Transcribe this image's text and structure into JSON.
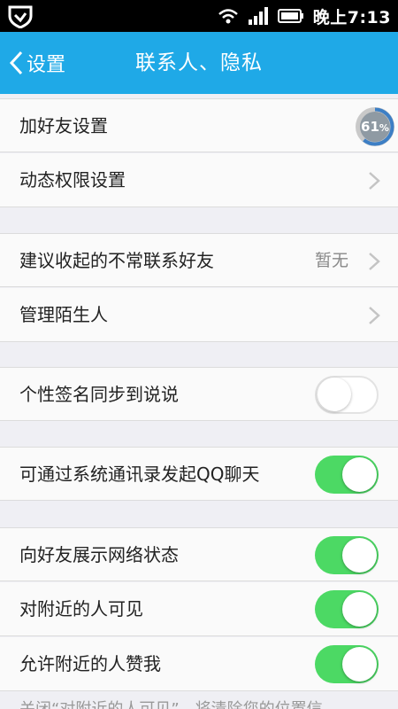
{
  "status_bar": {
    "time": "晚上7:13",
    "icons": [
      "shield-icon",
      "wifi-icon",
      "signal-icon",
      "battery-icon"
    ]
  },
  "nav": {
    "back_label": "设置",
    "title": "联系人、隐私"
  },
  "progress": {
    "value": "61",
    "unit": "%",
    "fraction": 0.61
  },
  "rows": [
    {
      "label": "加好友设置"
    },
    {
      "label": "动态权限设置"
    },
    {
      "label": "建议收起的不常联系好友",
      "value": "暂无"
    },
    {
      "label": "管理陌生人"
    },
    {
      "label": "个性签名同步到说说",
      "on": false
    },
    {
      "label": "可通过系统通讯录发起QQ聊天",
      "on": true
    },
    {
      "label": "向好友展示网络状态",
      "on": true
    },
    {
      "label": "对附近的人可见",
      "on": true
    },
    {
      "label": "允许附近的人赞我",
      "on": true
    }
  ],
  "bottom_note": "关闭“对附近的人可见”，将清除您的位置信",
  "colors": {
    "nav_bg": "#1fa9e7",
    "toggle_on": "#4cd964",
    "page_bg": "#efeff4"
  }
}
